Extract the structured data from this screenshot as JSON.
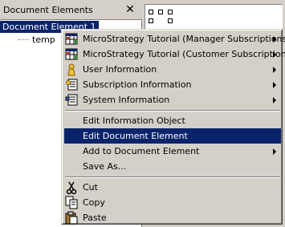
{
  "panel": {
    "title": "Document Elements",
    "close_glyph": "✕",
    "tree_root": "Document Element 1",
    "tree_child": "temp"
  },
  "context_menu": {
    "items": [
      {
        "label": "MicroStrategy Tutorial (Manager Subscriptions)",
        "icon": "grid-icon",
        "submenu": true
      },
      {
        "label": "MicroStrategy Tutorial (Customer Subscriptions)",
        "icon": "grid-icon",
        "submenu": true
      },
      {
        "label": "User Information",
        "icon": "user-icon",
        "submenu": true
      },
      {
        "label": "Subscription Information",
        "icon": "subscription-icon",
        "submenu": true
      },
      {
        "label": "System Information",
        "icon": "system-info-icon",
        "submenu": true
      },
      {
        "label": "Edit Information Object",
        "submenu": false
      },
      {
        "label": "Edit Document Element",
        "submenu": false,
        "highlighted": true
      },
      {
        "label": "Add to Document Element",
        "submenu": true
      },
      {
        "label": "Save As...",
        "submenu": false
      },
      {
        "label": "Cut",
        "icon": "scissors-icon",
        "submenu": false
      },
      {
        "label": "Copy",
        "icon": "copy-icon",
        "submenu": false
      },
      {
        "label": "Paste",
        "icon": "paste-icon",
        "submenu": false
      }
    ]
  },
  "colors": {
    "selection": "#0a246a",
    "face": "#d4d0c8"
  }
}
